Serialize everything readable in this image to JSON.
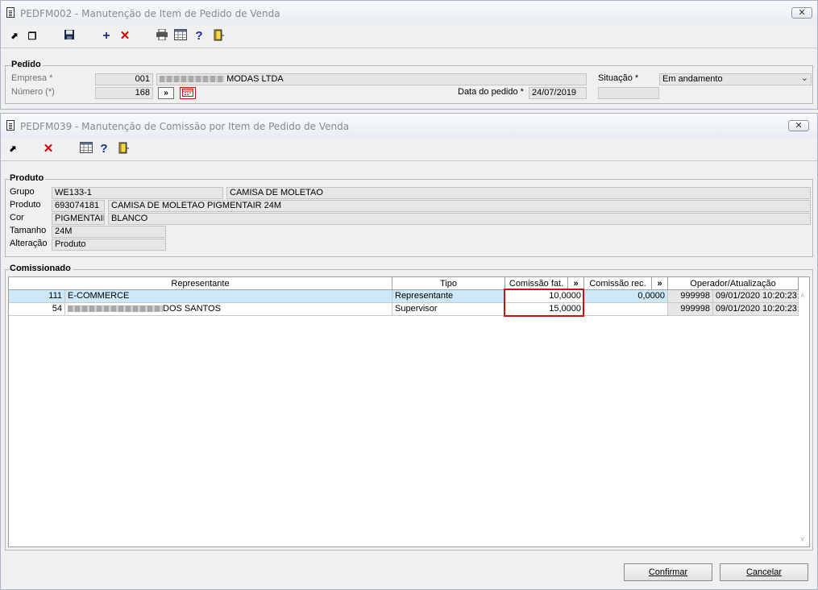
{
  "pedido_window": {
    "title": "PEDFM002 - Manutenção de Item de Pedido de Venda",
    "group_title": "Pedido",
    "empresa_label": "Empresa *",
    "empresa_code": "001",
    "empresa_name": "MODAS LTDA",
    "numero_label": "Número (*)",
    "numero_value": "168",
    "expand_glyph": "»",
    "data_label": "Data do pedido *",
    "data_value": "24/07/2019",
    "situacao_label": "Situação *",
    "situacao_value": "Em andamento"
  },
  "comissao_window": {
    "title": "PEDFM039 - Manutenção de Comissão por Item de Pedido de Venda",
    "produto_group_title": "Produto",
    "grupo_label": "Grupo",
    "grupo_code": "WE133-1",
    "grupo_desc": "CAMISA DE MOLETAO",
    "produto_label": "Produto",
    "produto_code": "693074181",
    "produto_desc": "CAMISA DE MOLETAO PIGMENTAIR 24M",
    "cor_label": "Cor",
    "cor_code": "PIGMENTAIR",
    "cor_desc": "BLANCO",
    "tamanho_label": "Tamanho",
    "tamanho_value": "24M",
    "alteracao_label": "Alteração",
    "alteracao_value": "Produto",
    "comissionado_group_title": "Comissionado",
    "columns": {
      "representante": "Representante",
      "tipo": "Tipo",
      "comissao_fat": "Comissão fat.",
      "comissao_rec": "Comissão rec.",
      "operador": "Operador/Atualização",
      "expand": "»"
    },
    "rows": [
      {
        "codigo": "111",
        "nome": "E-COMMERCE",
        "tipo": "Representante",
        "comissao_fat": "10,0000",
        "comissao_rec": "0,0000",
        "operador": "999998",
        "atualizacao": "09/01/2020 10:20:23"
      },
      {
        "codigo": "54",
        "nome": "DOS SANTOS",
        "tipo": "Supervisor",
        "comissao_fat": "15,0000",
        "comissao_rec": "",
        "operador": "999998",
        "atualizacao": "09/01/2020 10:20:23"
      }
    ],
    "confirm_label": "Confirmar",
    "cancel_label": "Cancelar"
  },
  "colors": {
    "highlight_border": "#d01010",
    "selected_row": "#cde8f8",
    "delete_icon": "#d00000",
    "add_icon": "#1a2a9a",
    "help_icon": "#1a2a9a"
  }
}
